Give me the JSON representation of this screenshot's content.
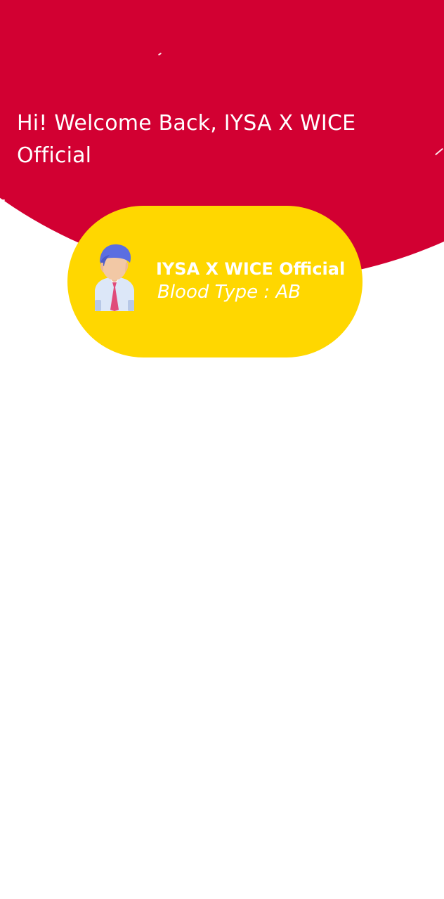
{
  "header": {
    "greeting": "Hi! Welcome Back, IYSA X WICE Official"
  },
  "profile": {
    "name": "IYSA X WICE Official",
    "blood_type_label": "Blood Type",
    "blood_type_separator": " : ",
    "blood_type_value": "AB",
    "avatar_icon": "person-avatar-icon"
  },
  "colors": {
    "background": "#ffffff",
    "hero": "#d20032",
    "card": "#ffd700",
    "text": "#ffffff",
    "avatar_hair": "#5b6ee1",
    "avatar_skin": "#f2c8a5",
    "avatar_shirt": "#dce7f8",
    "avatar_tie": "#e04b7a"
  }
}
